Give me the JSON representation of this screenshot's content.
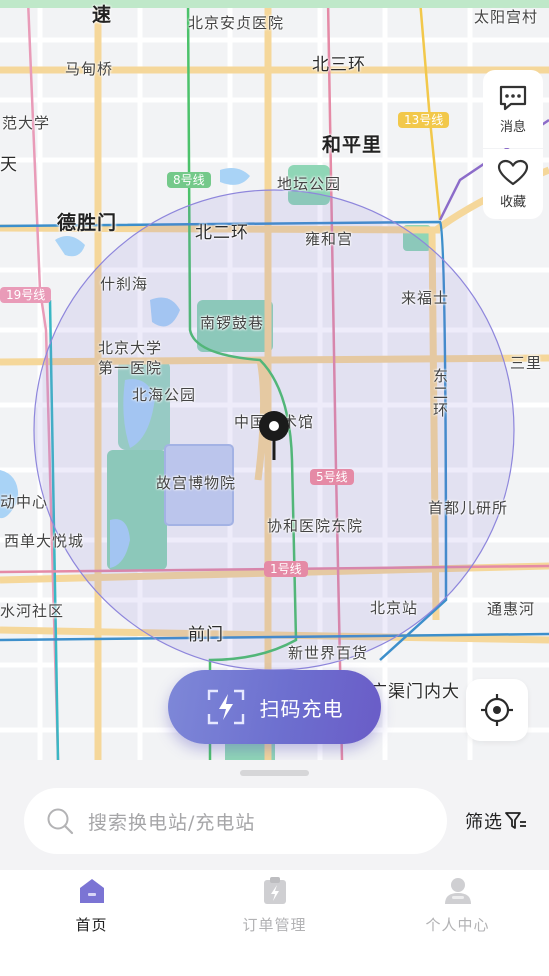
{
  "map": {
    "places": [
      {
        "id": "ji",
        "text": "速"
      },
      {
        "id": "anzhen",
        "text": "北京安贞医院"
      },
      {
        "id": "taiyanggong",
        "text": "太阳宫村"
      },
      {
        "id": "madian",
        "text": "马甸桥"
      },
      {
        "id": "beisanhuan",
        "text": "北三环"
      },
      {
        "id": "fandaxue",
        "text": "范大学"
      },
      {
        "id": "hepingli",
        "text": "和平里"
      },
      {
        "id": "tian",
        "text": "天"
      },
      {
        "id": "ditan",
        "text": "地坛公园"
      },
      {
        "id": "deshengmen",
        "text": "德胜门"
      },
      {
        "id": "beierhuan",
        "text": "北二环"
      },
      {
        "id": "yonghegong",
        "text": "雍和宫"
      },
      {
        "id": "shichahai",
        "text": "什刹海"
      },
      {
        "id": "laifushi",
        "text": "来福士"
      },
      {
        "id": "nanluo",
        "text": "南锣鼓巷"
      },
      {
        "id": "bdyy",
        "text": "北京大学第一医院"
      },
      {
        "id": "sanli",
        "text": "三里"
      },
      {
        "id": "beihai",
        "text": "北海公园"
      },
      {
        "id": "donger",
        "text": "东二环"
      },
      {
        "id": "meishuguan",
        "text": "中国美术馆"
      },
      {
        "id": "gugong",
        "text": "故宫博物院"
      },
      {
        "id": "zhongxin",
        "text": "动中心"
      },
      {
        "id": "shoudu",
        "text": "首都儿研所"
      },
      {
        "id": "xidan",
        "text": "西单大悦城"
      },
      {
        "id": "xiehe",
        "text": "协和医院东院"
      },
      {
        "id": "shuihe",
        "text": "水河社区"
      },
      {
        "id": "bjz",
        "text": "北京站"
      },
      {
        "id": "tonghui",
        "text": "通惠河"
      },
      {
        "id": "qianmen",
        "text": "前门"
      },
      {
        "id": "xsj",
        "text": "新世界百货"
      },
      {
        "id": "guangqu",
        "text": "广渠门内大"
      }
    ],
    "lines": [
      {
        "id": "l13",
        "text": "13号线",
        "color": "#f2c84b"
      },
      {
        "id": "l8",
        "text": "8号线",
        "color": "#74c98a"
      },
      {
        "id": "l19",
        "text": "19号线",
        "color": "#e99bb8"
      },
      {
        "id": "l5",
        "text": "5号线",
        "color": "#e58aa6"
      },
      {
        "id": "l1",
        "text": "1号线",
        "color": "#e58aa6"
      }
    ],
    "search_radius_color": "#7b6fd6"
  },
  "side": {
    "message_label": "消息",
    "message_icon": "message-icon",
    "favorite_label": "收藏",
    "favorite_icon": "heart-icon"
  },
  "scan_button": {
    "label": "扫码充电",
    "icon": "scan-charge-icon"
  },
  "locate_button": {
    "icon": "locate-icon"
  },
  "search": {
    "placeholder": "搜索换电站/充电站",
    "icon": "search-icon"
  },
  "filter": {
    "label": "筛选",
    "icon": "filter-icon"
  },
  "tabs": [
    {
      "label": "首页",
      "icon": "home-icon",
      "active": true
    },
    {
      "label": "订单管理",
      "icon": "order-icon",
      "active": false
    },
    {
      "label": "个人中心",
      "icon": "user-icon",
      "active": false
    }
  ],
  "colors": {
    "accent": "#6d6fcf",
    "primary_text": "#222222",
    "inactive_tab": "#b2b2b4"
  }
}
